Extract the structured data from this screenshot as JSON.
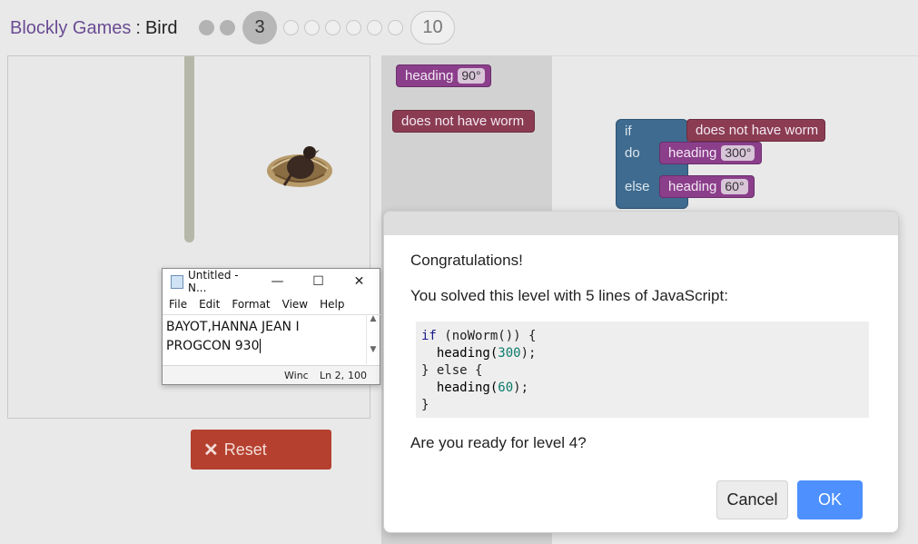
{
  "header": {
    "app": "Blockly Games",
    "separator": ":",
    "game": "Bird"
  },
  "levels": {
    "current": "3",
    "last": "10"
  },
  "reset": {
    "icon": "close-x-icon",
    "label": "Reset"
  },
  "toolbox": {
    "heading_label": "heading",
    "heading_value": "90°",
    "condition_label": "does not have worm"
  },
  "workspace": {
    "if_label": "if",
    "do_label": "do",
    "else_label": "else",
    "condition_label": "does not have worm",
    "heading1_label": "heading",
    "heading1_value": "300°",
    "heading2_label": "heading",
    "heading2_value": "60°"
  },
  "notepad": {
    "title": "Untitled - N...",
    "menu": [
      "File",
      "Edit",
      "Format",
      "View",
      "Help"
    ],
    "lines": [
      "BAYOT,HANNA JEAN I",
      "PROGCON 930"
    ],
    "status": {
      "encoding": "Winc",
      "position": "Ln 2,",
      "zoom": "100"
    }
  },
  "dialog": {
    "heading": "Congratulations!",
    "message": "You solved this level with 5 lines of JavaScript:",
    "code": {
      "l1_kw": "if",
      "l1_rest": " (noWorm()) {",
      "l2_fn": "  heading(",
      "l2_num": "300",
      "l2_end": ");",
      "l3": "} else {",
      "l4_fn": "  heading(",
      "l4_num": "60",
      "l4_end": ");",
      "l5": "}"
    },
    "question": "Are you ready for level 4?",
    "cancel_label": "Cancel",
    "ok_label": "OK"
  },
  "colors": {
    "accent": "#4d90fe",
    "reset": "#b5402f",
    "motion_block": "#8b3f8b",
    "sensor_block": "#8b3c52",
    "logic_block": "#3e6b8f"
  }
}
